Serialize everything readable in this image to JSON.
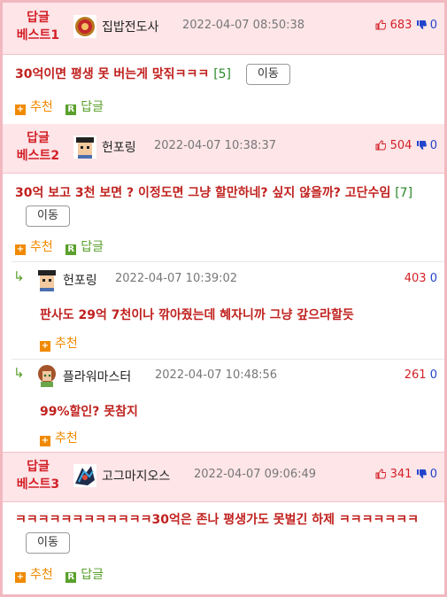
{
  "sections": [
    {
      "rank_line1": "답글",
      "rank_line2": "베스트1",
      "nickname": "집밥전도사",
      "date": "2022-04-07 08:50:38",
      "up": "683",
      "down": "0",
      "title": "30억이면 평생 못 버는게 맞짂ㅋㅋㅋ",
      "reply_count": "[5]",
      "move_label": "이동",
      "recommend_label": "추천",
      "reply_label": "답글"
    },
    {
      "rank_line1": "답글",
      "rank_line2": "베스트2",
      "nickname": "헌포링",
      "date": "2022-04-07 10:38:37",
      "up": "504",
      "down": "0",
      "title": "30억 보고 3천 보면 ? 이정도면 그냥 할만하네? 싶지 않을까? 고단수임",
      "reply_count": "[7]",
      "move_label": "이동",
      "recommend_label": "추천",
      "reply_label": "답글",
      "replies": [
        {
          "nickname": "헌포링",
          "date": "2022-04-07 10:39:02",
          "up": "403",
          "down": "0",
          "text": "판사도 29억 7천이나 깎아줬는데 혜자니까 그냥 갚으라할듯",
          "recommend_label": "추천"
        },
        {
          "nickname": "플라워마스터",
          "date": "2022-04-07 10:48:56",
          "up": "261",
          "down": "0",
          "text": "99%할인? 못참지",
          "recommend_label": "추천"
        }
      ]
    },
    {
      "rank_line1": "답글",
      "rank_line2": "베스트3",
      "nickname": "고그마지오스",
      "date": "2022-04-07 09:06:49",
      "up": "341",
      "down": "0",
      "title": "ㅋㅋㅋㅋㅋㅋㅋㅋㅋㅋㅋㅋ30억은 존나 평생가도 못벌긴 하제 ㅋㅋㅋㅋㅋㅋㅋ",
      "move_label": "이동",
      "recommend_label": "추천",
      "reply_label": "답글"
    }
  ],
  "icons": {
    "thumb_up": "thumbs-up-icon",
    "thumb_down": "thumbs-down-icon",
    "plus": "plus-icon",
    "reply": "reply-icon",
    "reply_arrow": "reply-arrow-icon"
  },
  "colors": {
    "accent_red": "#d32027",
    "header_pink": "#fde5e8",
    "frame_pink": "#f2b8c0",
    "orange": "#f08a00",
    "green": "#5aa02c",
    "blue": "#2244cc"
  }
}
